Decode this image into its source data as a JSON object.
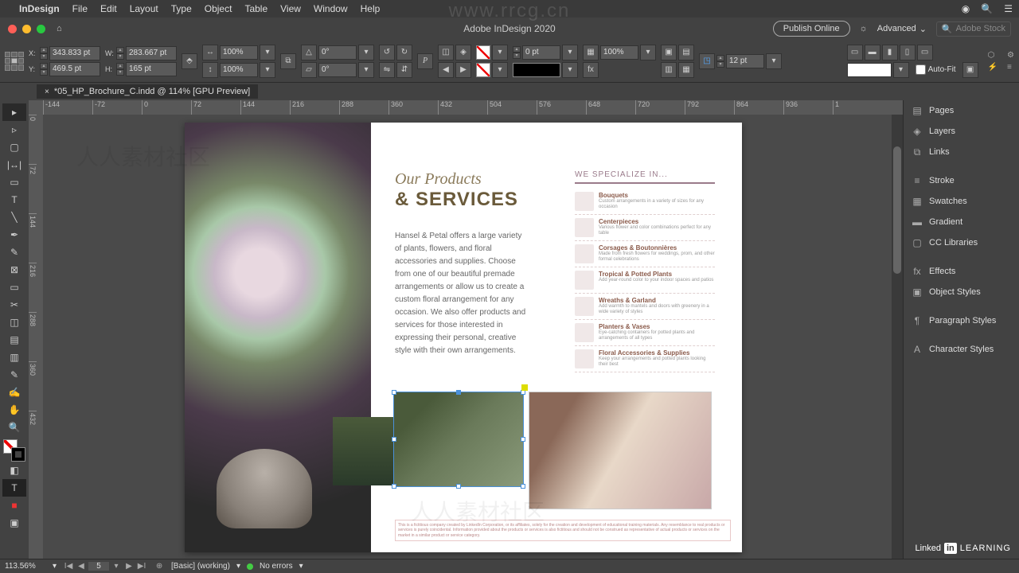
{
  "menubar": {
    "app": "InDesign",
    "items": [
      "File",
      "Edit",
      "Layout",
      "Type",
      "Object",
      "Table",
      "View",
      "Window",
      "Help"
    ]
  },
  "titlebar": {
    "title": "Adobe InDesign 2020",
    "publish": "Publish Online",
    "workspace": "Advanced",
    "search_placeholder": "Adobe Stock"
  },
  "control": {
    "x": "343.833 pt",
    "y": "469.5 pt",
    "w": "283.667 pt",
    "h": "165 pt",
    "scale_x": "100%",
    "scale_y": "100%",
    "rotate": "0°",
    "shear": "0°",
    "stroke_weight": "0 pt",
    "gap": "12 pt",
    "opacity": "100%",
    "autofit": "Auto-Fit"
  },
  "doc_tab": {
    "name": "*05_HP_Brochure_C.indd @ 114% [GPU Preview]"
  },
  "ruler_h": [
    "-144",
    "-72",
    "0",
    "72",
    "144",
    "216",
    "288",
    "360",
    "432",
    "504",
    "576",
    "648",
    "720",
    "792",
    "864",
    "936",
    "1"
  ],
  "ruler_v": [
    "0",
    "72",
    "144",
    "216",
    "288",
    "360",
    "432"
  ],
  "panels": {
    "group1": [
      "Pages",
      "Layers",
      "Links"
    ],
    "group2": [
      "Stroke",
      "Swatches",
      "Gradient",
      "CC Libraries"
    ],
    "group3": [
      "Effects",
      "Object Styles"
    ],
    "group4": [
      "Paragraph Styles"
    ],
    "group5": [
      "Character Styles"
    ]
  },
  "spread": {
    "title_script": "Our Products",
    "title_caps": "& SERVICES",
    "body": "Hansel & Petal offers a large variety of plants, flowers, and floral accessories and supplies. Choose from one of our beautiful premade arrangements or allow us to create a custom floral arrangement for any occasion. We also offer products and services for those interested in expressing their personal, creative style with their own arrangements.",
    "spec_title": "WE SPECIALIZE IN...",
    "spec_items": [
      {
        "name": "Bouquets",
        "desc": "Custom arrangements in a variety of sizes for any occasion"
      },
      {
        "name": "Centerpieces",
        "desc": "Various flower and color combinations perfect for any table"
      },
      {
        "name": "Corsages & Boutonnières",
        "desc": "Made from fresh flowers for weddings, prom, and other formal celebrations"
      },
      {
        "name": "Tropical & Potted Plants",
        "desc": "Add year-round color to your indoor spaces and patios"
      },
      {
        "name": "Wreaths & Garland",
        "desc": "Add warmth to mantels and doors with greenery in a wide variety of styles"
      },
      {
        "name": "Planters & Vases",
        "desc": "Eye-catching containers for potted plants and arrangements of all types"
      },
      {
        "name": "Floral Accessories & Supplies",
        "desc": "Keep your arrangements and potted plants looking their best"
      }
    ],
    "footer": "This is a fictitious company created by LinkedIn Corporation, or its affiliates, solely for the creation and development of educational training materials. Any resemblance to real products or services is purely coincidental. Information provided about the products or services is also fictitious and should not be construed as representative of actual products or services on the market in a similar product or service category."
  },
  "status": {
    "zoom": "113.56%",
    "page": "5",
    "working": "[Basic] (working)",
    "errors": "No errors"
  },
  "watermark_url": "www.rrcg.cn",
  "watermark_cn": "人人素材社区",
  "linkedin": {
    "linked": "Linked",
    "in": "in",
    "learning": "LEARNING"
  }
}
